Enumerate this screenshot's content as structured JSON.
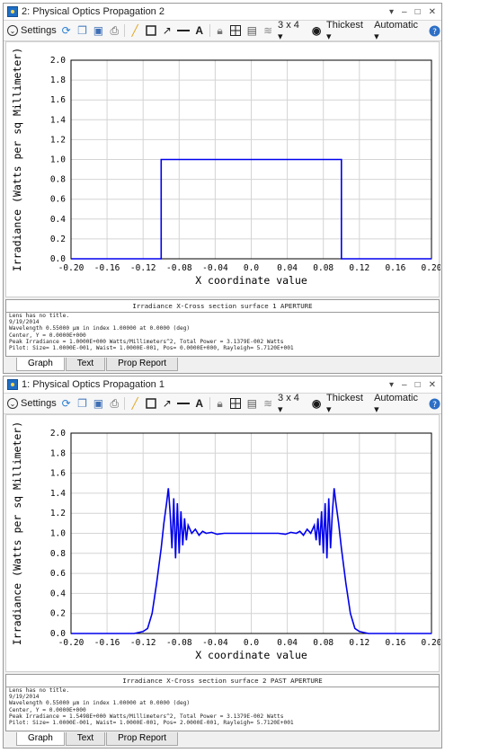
{
  "windows": [
    {
      "title": "2: Physical Optics Propagation 2",
      "caption": {
        "title": "Irradiance X-Cross section surface 1 APERTURE",
        "lines": [
          "Lens has no title.",
          "9/19/2014",
          "Wavelength 0.55000 µm in index 1.00000 at 0.0000 (deg)",
          "Center, Y = 0.0000E+000",
          "Peak Irradiance = 1.0000E+000 Watts/Millimeters^2, Total Power = 3.1379E-002 Watts",
          "Pilot: Size= 1.0000E-001, Waist= 1.0000E-001, Pos= 0.0000E+000, Rayleigh= 5.7120E+001"
        ]
      }
    },
    {
      "title": "1: Physical Optics Propagation 1",
      "caption": {
        "title": "Irradiance X-Cross section surface 2 PAST APERTURE",
        "lines": [
          "Lens has no title.",
          "9/19/2014",
          "Wavelength 0.55000 µm in index 1.00000 at 0.0000 (deg)",
          "Center, Y = 0.0000E+000",
          "Peak Irradiance = 1.5498E+000 Watts/Millimeters^2, Total Power = 3.1379E-002 Watts",
          "Pilot: Size= 1.0000E-001, Waist= 1.0000E-001, Pos= 2.0000E-001, Rayleigh= 5.7120E+001"
        ]
      }
    }
  ],
  "window_controls": {
    "dropdown": "▾",
    "minimize": "–",
    "restore": "□",
    "close": "✕"
  },
  "toolbar": {
    "settings_label": "Settings",
    "layout_label": "3 x 4 ▾",
    "line_label": "Thickest ▾",
    "scale_label": "Automatic ▾",
    "text_icon": "A"
  },
  "tabs": [
    "Graph",
    "Text",
    "Prop Report"
  ],
  "colors": {
    "line": "#0000ee",
    "grid": "#d4d4d4",
    "axis": "#000000"
  },
  "chart_data": [
    {
      "type": "line",
      "xlabel": "X coordinate value",
      "ylabel": "Irradiance (Watts per sq Millimeter)",
      "xlim": [
        -0.2,
        0.2
      ],
      "ylim": [
        0.0,
        2.0
      ],
      "xticks": [
        "-0.20",
        "-0.16",
        "-0.12",
        "-0.08",
        "-0.04",
        "0.0",
        "0.04",
        "0.08",
        "0.12",
        "0.16",
        "0.20"
      ],
      "yticks": [
        "0.0",
        "0.2",
        "0.4",
        "0.6",
        "0.8",
        "1.0",
        "1.2",
        "1.4",
        "1.6",
        "1.8",
        "2.0"
      ],
      "grid": true,
      "series": [
        {
          "x": [
            -0.2,
            -0.1,
            -0.1,
            0.1,
            0.1,
            0.2
          ],
          "y": [
            0.0,
            0.0,
            1.0,
            1.0,
            0.0,
            0.0
          ]
        }
      ]
    },
    {
      "type": "line",
      "xlabel": "X coordinate value",
      "ylabel": "Irradiance (Watts per sq Millimeter)",
      "xlim": [
        -0.2,
        0.2
      ],
      "ylim": [
        0.0,
        2.0
      ],
      "xticks": [
        "-0.20",
        "-0.16",
        "-0.12",
        "-0.08",
        "-0.04",
        "0.0",
        "0.04",
        "0.08",
        "0.12",
        "0.16",
        "0.20"
      ],
      "yticks": [
        "0.0",
        "0.2",
        "0.4",
        "0.6",
        "0.8",
        "1.0",
        "1.2",
        "1.4",
        "1.6",
        "1.8",
        "2.0"
      ],
      "grid": true,
      "series": [
        {
          "x": [
            -0.2,
            -0.13,
            -0.12,
            -0.115,
            -0.11,
            -0.105,
            -0.1,
            -0.097,
            -0.094,
            -0.092,
            -0.09,
            -0.088,
            -0.086,
            -0.084,
            -0.082,
            -0.08,
            -0.078,
            -0.076,
            -0.074,
            -0.072,
            -0.07,
            -0.066,
            -0.062,
            -0.058,
            -0.054,
            -0.05,
            -0.044,
            -0.038,
            -0.03,
            -0.02,
            -0.01,
            0.0,
            0.01,
            0.02,
            0.03,
            0.038,
            0.044,
            0.05,
            0.054,
            0.058,
            0.062,
            0.066,
            0.07,
            0.072,
            0.074,
            0.076,
            0.078,
            0.08,
            0.082,
            0.084,
            0.086,
            0.088,
            0.09,
            0.092,
            0.094,
            0.097,
            0.1,
            0.105,
            0.11,
            0.115,
            0.12,
            0.13,
            0.2
          ],
          "y": [
            0.0,
            0.0,
            0.02,
            0.05,
            0.2,
            0.5,
            0.85,
            1.1,
            1.3,
            1.45,
            1.2,
            0.85,
            1.35,
            0.75,
            1.3,
            0.8,
            1.22,
            0.88,
            1.15,
            0.93,
            1.08,
            1.0,
            1.04,
            0.98,
            1.02,
            1.0,
            1.01,
            0.99,
            1.0,
            1.0,
            1.0,
            1.0,
            1.0,
            1.0,
            1.0,
            0.99,
            1.01,
            1.0,
            1.02,
            0.98,
            1.04,
            1.0,
            1.08,
            0.93,
            1.15,
            0.88,
            1.22,
            0.8,
            1.3,
            0.75,
            1.35,
            0.85,
            1.2,
            1.45,
            1.3,
            1.1,
            0.85,
            0.5,
            0.2,
            0.05,
            0.02,
            0.0,
            0.0
          ]
        }
      ]
    }
  ]
}
